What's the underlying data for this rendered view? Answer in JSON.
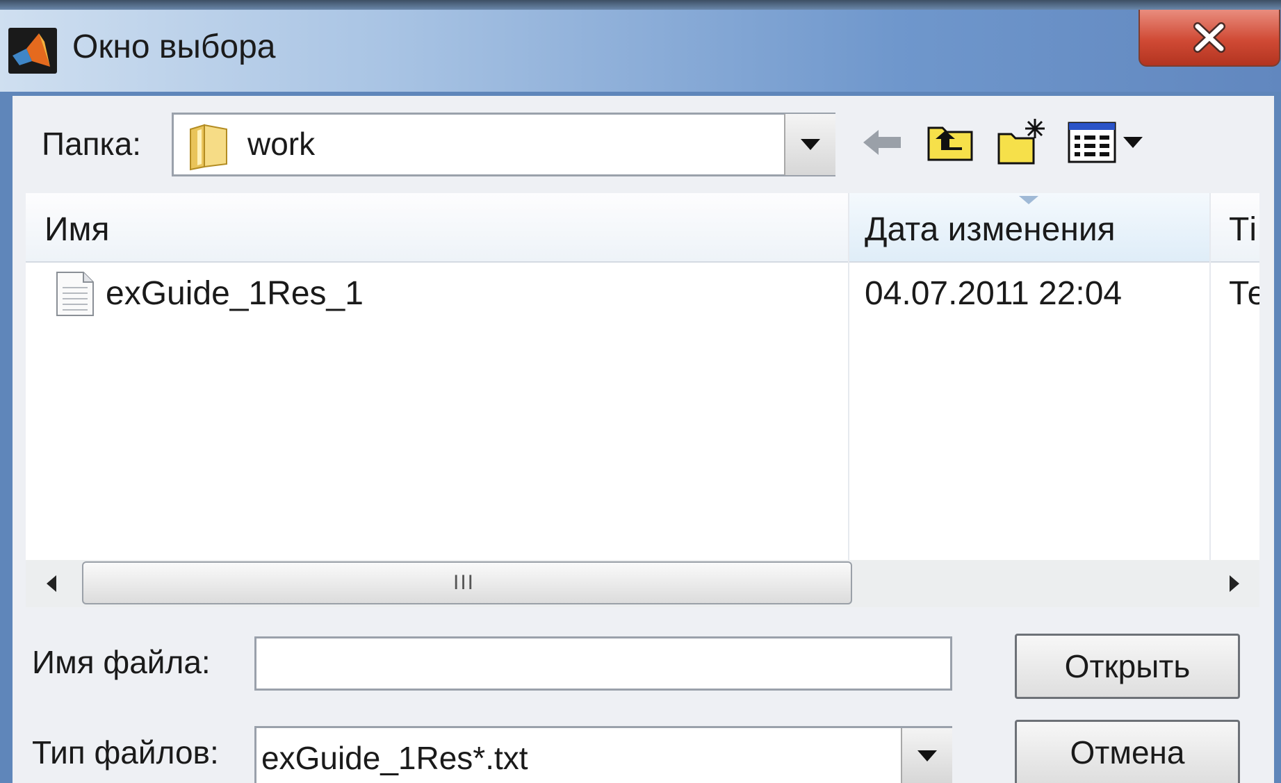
{
  "window": {
    "title": "Окно выбора",
    "close_glyph": "X"
  },
  "toolbar": {
    "folder_label": "Папка:",
    "folder_value": "work",
    "icons": [
      "back-arrow-icon",
      "up-folder-icon",
      "new-folder-icon",
      "view-menu-icon"
    ]
  },
  "file_list": {
    "columns": [
      "Имя",
      "Дата изменения",
      "Ті"
    ],
    "rows": [
      {
        "name": "exGuide_1Res_1",
        "date": "04.07.2011 22:04",
        "type": "Те"
      }
    ],
    "scroll_grip": "III"
  },
  "form": {
    "filename_label": "Имя файла:",
    "filename_value": "",
    "filetype_label": "Тип файлов:",
    "filetype_value": "exGuide_1Res*.txt",
    "open_button": "Открыть",
    "cancel_button": "Отмена"
  },
  "colors": {
    "title_accent": "#6f97cc",
    "close_button": "#d04a35"
  }
}
